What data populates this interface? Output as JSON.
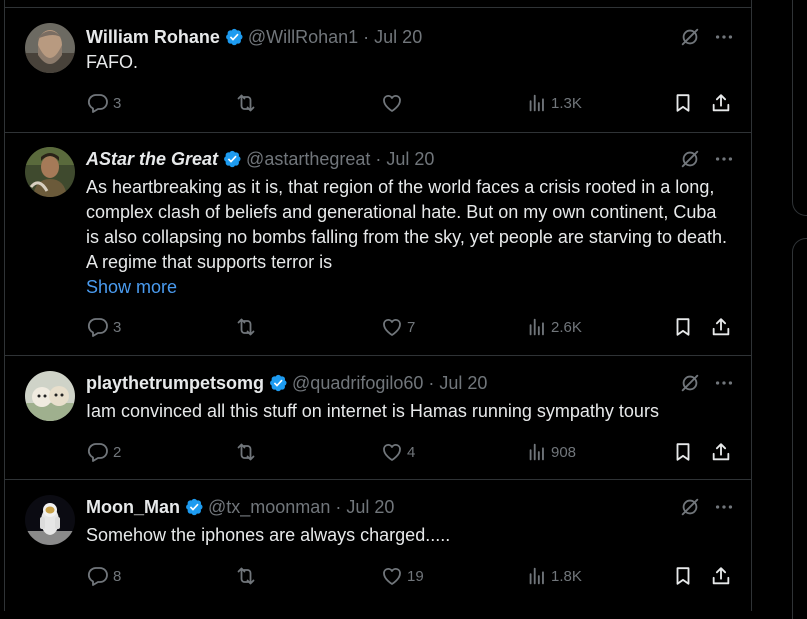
{
  "tweets": [
    {
      "name": "William Rohane",
      "handle": "@WillRohan1",
      "dot": "·",
      "date": "Jul 20",
      "text": "FAFO.",
      "replies": "3",
      "reposts": "",
      "likes": "",
      "views": "1.3K"
    },
    {
      "name": "AStar the Great",
      "handle": "@astarthegreat",
      "dot": "·",
      "date": "Jul 20",
      "text": "As heartbreaking as it is, that region of the world faces a crisis rooted in a long, complex clash of beliefs and generational hate. But on my own continent, Cuba is also collapsing no bombs falling from the sky, yet people are starving to death. A regime that supports terror is",
      "show_more": "Show more",
      "replies": "3",
      "reposts": "",
      "likes": "7",
      "views": "2.6K"
    },
    {
      "name": "playthetrumpetsomg",
      "handle": "@quadrifogilo60",
      "dot": "·",
      "date": "Jul 20",
      "text": "Iam convinced all this stuff on internet is Hamas running sympathy tours",
      "replies": "2",
      "reposts": "",
      "likes": "4",
      "views": "908"
    },
    {
      "name": "Moon_Man",
      "handle": "@tx_moonman",
      "dot": "·",
      "date": "Jul 20",
      "text": "Somehow the iphones are always charged.....",
      "replies": "8",
      "reposts": "",
      "likes": "19",
      "views": "1.8K"
    }
  ],
  "colors": {
    "background": "#000000",
    "text": "#e7e9ea",
    "muted": "#71767b",
    "link": "#4a9bef",
    "verified": "#1d9bf0",
    "divider": "#2f3336"
  },
  "icons": {
    "verified": "verified-badge-icon",
    "grok": "grok-icon",
    "more": "more-icon",
    "reply": "reply-icon",
    "repost": "repost-icon",
    "like": "like-icon",
    "views": "views-icon",
    "bookmark": "bookmark-icon",
    "share": "share-icon"
  }
}
